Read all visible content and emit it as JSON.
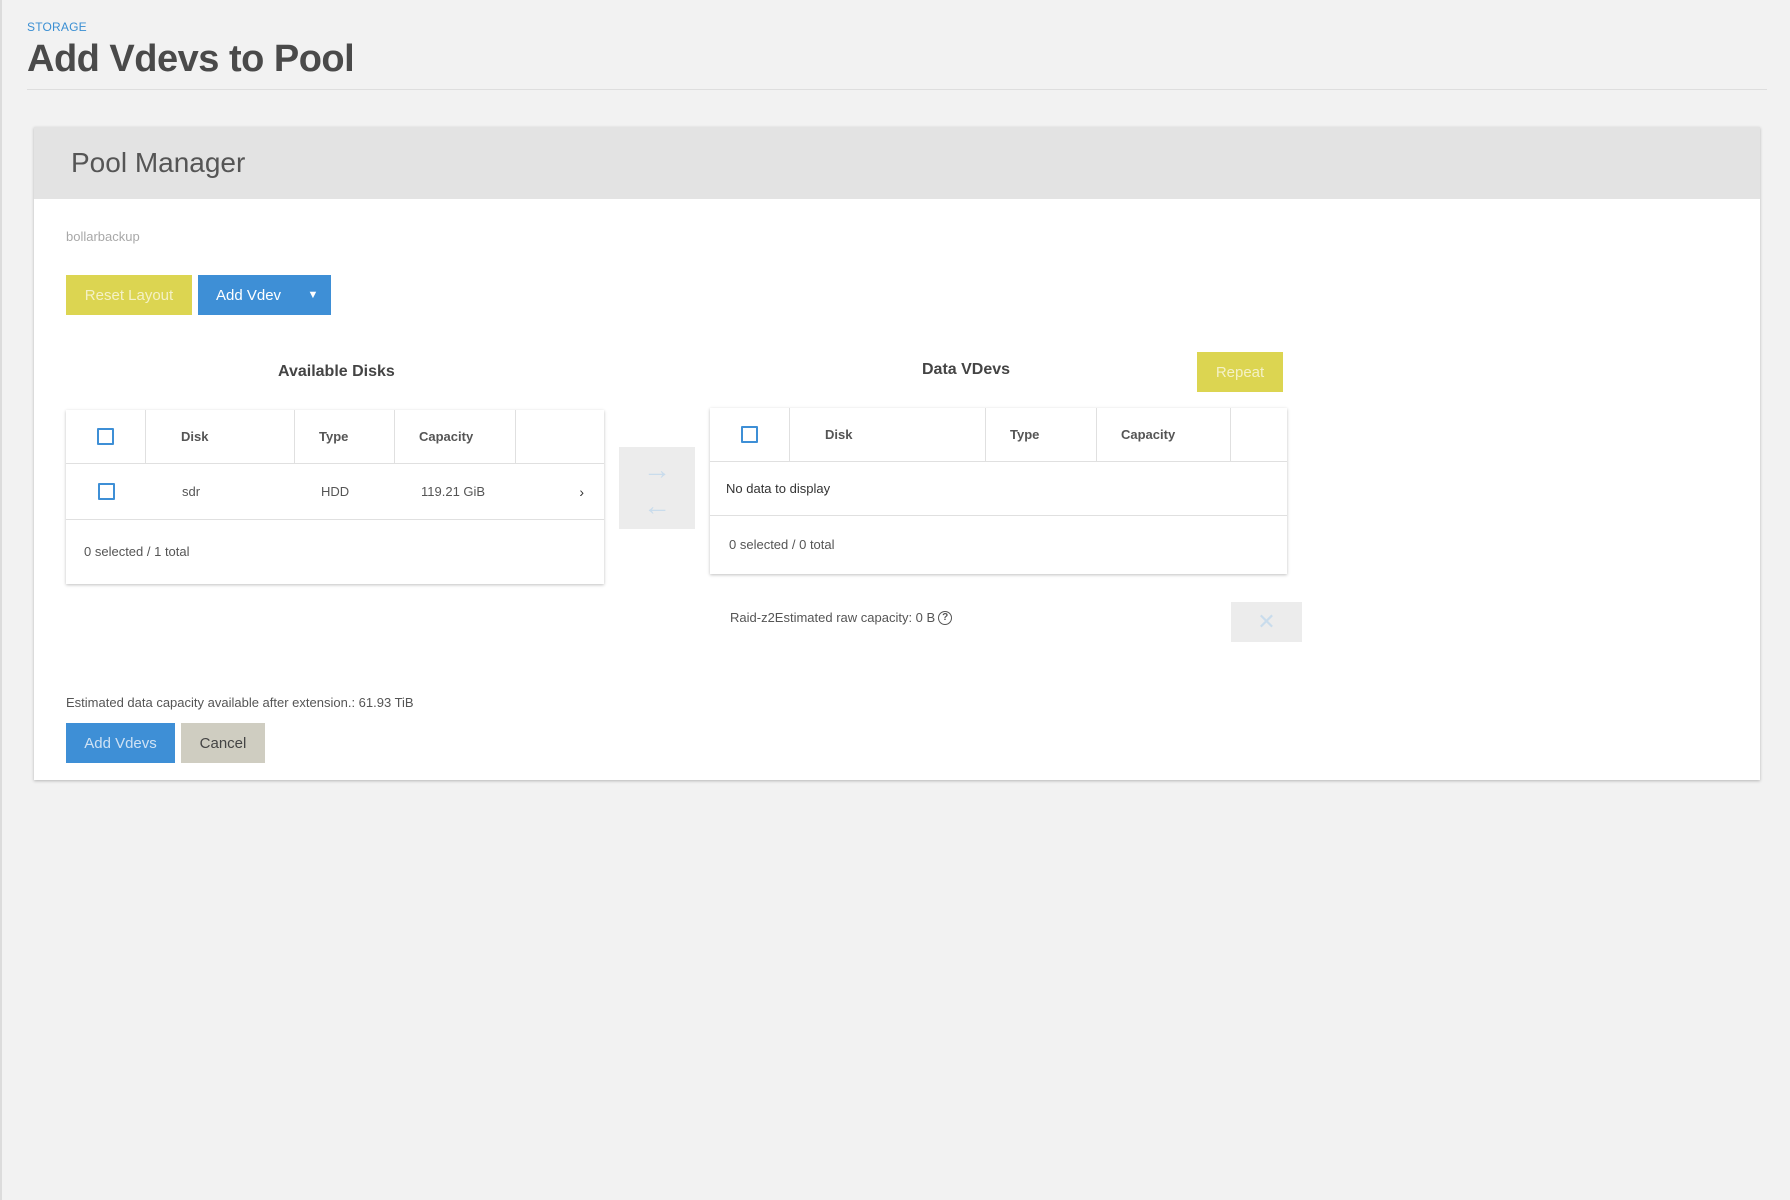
{
  "header": {
    "breadcrumb": "STORAGE",
    "title": "Add Vdevs to Pool"
  },
  "card": {
    "title": "Pool Manager",
    "pool_name": "bollarbackup"
  },
  "toolbar": {
    "reset_label": "Reset Layout",
    "add_vdev_label": "Add Vdev"
  },
  "available_disks": {
    "title": "Available Disks",
    "columns": [
      "Disk",
      "Type",
      "Capacity"
    ],
    "rows": [
      {
        "disk": "sdr",
        "type": "HDD",
        "capacity": "119.21 GiB"
      }
    ],
    "footer": "0 selected / 1 total"
  },
  "data_vdevs": {
    "title": "Data VDevs",
    "repeat_label": "Repeat",
    "columns": [
      "Disk",
      "Type",
      "Capacity"
    ],
    "empty_text": "No data to display",
    "footer": "0 selected / 0 total",
    "info_text": "Raid-z2Estimated raw capacity: 0 B"
  },
  "footer": {
    "estimated_capacity": "Estimated data capacity available after extension.: 61.93 TiB",
    "add_vdevs_label": "Add Vdevs",
    "cancel_label": "Cancel"
  },
  "icons": {
    "move_right": "arrow-right-icon",
    "move_left": "arrow-left-icon",
    "help": "help-circle-icon",
    "remove": "close-icon",
    "expand": "chevron-right-icon",
    "dropdown": "caret-down-icon"
  },
  "colors": {
    "primary": "#3e8fd6",
    "accent_yellow": "#dcd551",
    "cancel_grey": "#cfcdc1",
    "background": "#f2f2f2"
  }
}
